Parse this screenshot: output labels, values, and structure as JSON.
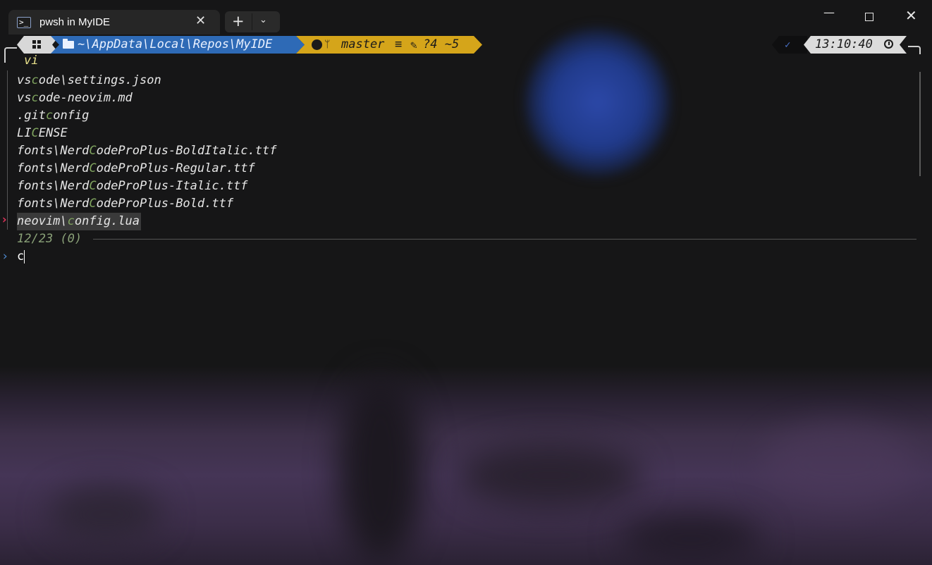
{
  "window": {
    "tab_title": "pwsh in MyIDE",
    "tab_close": "✕",
    "new_tab": "+",
    "dropdown": "⌄",
    "minimize": "—",
    "close": "✕"
  },
  "prompt": {
    "path": "~\\AppData\\Local\\Repos\\MyIDE",
    "branch": "master",
    "sync": "≡",
    "git_status": "?4 ~5",
    "time": "13:10:40",
    "check": "✓",
    "branch_glyph": "ᛘ",
    "edit_glyph": "✎"
  },
  "terminal": {
    "typed": "vi",
    "files": [
      [
        "vs",
        "c",
        "ode\\settings.json"
      ],
      [
        "vs",
        "c",
        "ode-neovim.md"
      ],
      [
        ".git",
        "c",
        "onfig"
      ],
      [
        "LI",
        "C",
        "ENSE"
      ],
      [
        "fonts\\Nerd",
        "C",
        "odeProPlus-BoldItalic.ttf"
      ],
      [
        "fonts\\Nerd",
        "C",
        "odeProPlus-Regular.ttf"
      ],
      [
        "fonts\\Nerd",
        "C",
        "odeProPlus-Italic.ttf"
      ],
      [
        "fonts\\Nerd",
        "C",
        "odeProPlus-Bold.ttf"
      ],
      [
        "neovim\\",
        "c",
        "onfig.lua"
      ]
    ],
    "selected_index": 8,
    "selected_marker": "›",
    "count": "12/23 (0)",
    "query_marker": "›",
    "query": "c"
  },
  "colors": {
    "path_segment": "#2e6ab6",
    "git_segment": "#d5a51a",
    "match_highlight": "#7fa35e",
    "selection_marker": "#e0335a"
  },
  "icons": [
    "powershell-icon",
    "windows-icon",
    "folder-icon",
    "github-icon",
    "branch-icon",
    "edit-icon",
    "check-icon",
    "clock-icon"
  ]
}
